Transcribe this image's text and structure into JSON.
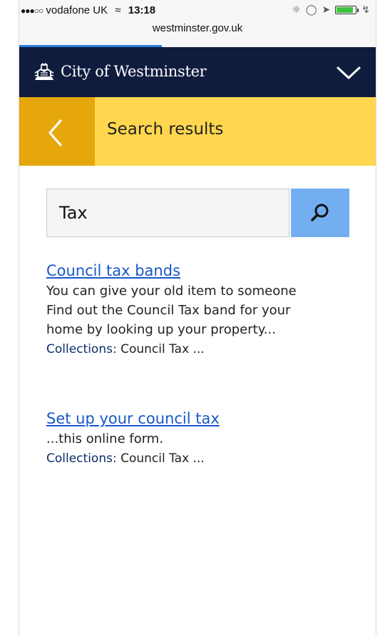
{
  "status_bar": {
    "signal": "●●●○○",
    "carrier": "vodafone UK",
    "wifi_icon": "wifi-icon",
    "time": "13:18",
    "url": "westminster.gov.uk",
    "load_progress": 0.4,
    "battery_level": 0.9,
    "battery_color": "#3fc23f"
  },
  "header": {
    "brand_name": "City of Westminster",
    "menu_icon": "chevron-down-icon",
    "background": "#101c3d"
  },
  "title_bar": {
    "back_icon": "chevron-left-icon",
    "title": "Search results",
    "background": "#ffd64e",
    "back_background": "#e5a70c"
  },
  "search": {
    "value": "Tax",
    "button_icon": "search-icon",
    "button_color": "#73aef0"
  },
  "results": [
    {
      "title": "Council tax bands",
      "snippet": [
        "You can give your old item to someone",
        "Find out the Council Tax band for your",
        "home by looking up your property..."
      ],
      "meta_label": "Collections:",
      "meta_value": "Council Tax ..."
    },
    {
      "title": "Set up your council tax",
      "snippet": [
        "...this online form."
      ],
      "meta_label": "Collections:",
      "meta_value": "Council Tax ..."
    }
  ]
}
